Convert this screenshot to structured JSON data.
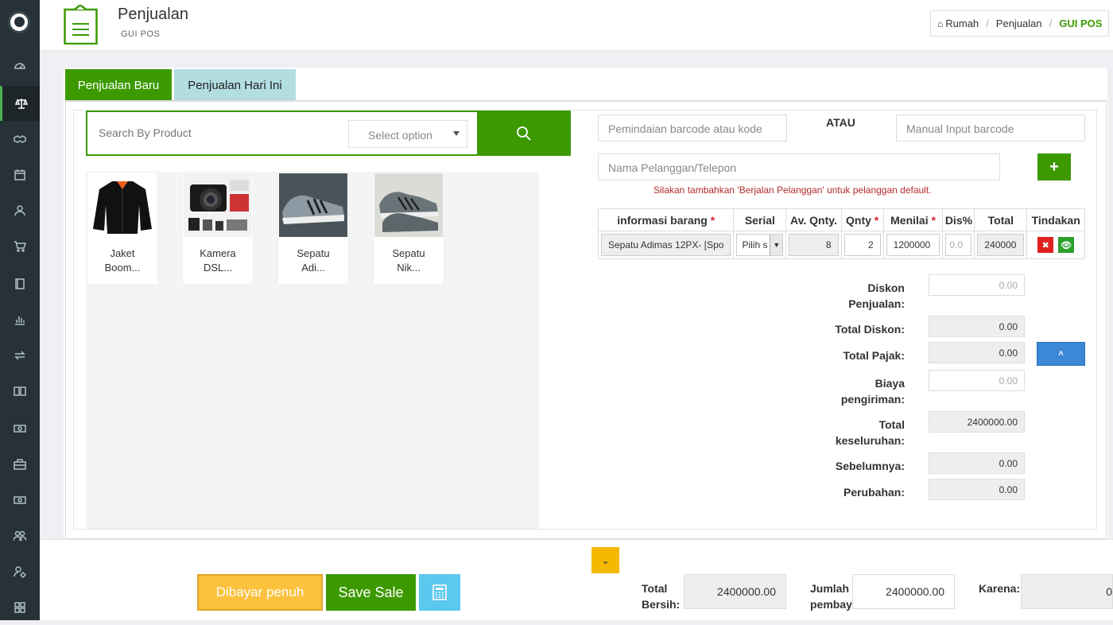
{
  "header": {
    "title": "Penjualan",
    "subtitle": "GUI POS",
    "breadcrumb": [
      "Rumah",
      "Penjualan",
      "GUI POS"
    ]
  },
  "sidebar": {
    "items": [
      "dashboard-icon",
      "scale-icon",
      "handshake-icon",
      "calendar-icon",
      "user-icon",
      "cart-icon",
      "book-icon",
      "bar-chart-icon",
      "exchange-icon",
      "open-book-icon",
      "money-icon",
      "briefcase-icon",
      "money-icon",
      "users-icon",
      "settings-user-icon",
      "grid-icon"
    ]
  },
  "tabs": [
    "Penjualan Baru",
    "Penjualan Hari Ini"
  ],
  "search": {
    "placeholder": "Search By Product",
    "select_option": "Select option"
  },
  "products": [
    {
      "name": "Jaket Boom...",
      "line1": "Jaket",
      "line2": "Boom..."
    },
    {
      "name": "Kamera DSL...",
      "line1": "Kamera",
      "line2": "DSL..."
    },
    {
      "name": "Sepatu Adi...",
      "line1": "Sepatu",
      "line2": "Adi..."
    },
    {
      "name": "Sepatu Nik...",
      "line1": "Sepatu",
      "line2": "Nik..."
    }
  ],
  "barcode_placeholder": "Pemindaian barcode atau kode",
  "or_label": "ATAU",
  "manual_placeholder": "Manual Input barcode",
  "customer_placeholder": "Nama Pelanggan/Telepon",
  "customer_hint": "Silakan tambahkan 'Berjalan Pelanggan' untuk pelanggan default.",
  "table": {
    "headers": [
      "informasi barang",
      "Serial",
      "Av. Qnty.",
      "Qnty",
      "Menilai",
      "Dis%",
      "Total",
      "Tindakan"
    ],
    "row": {
      "item": "Sepatu Adimas 12PX- [Spo",
      "serial": "Pilih s",
      "available": "8",
      "qty": "2",
      "price": "1200000",
      "discount": "0.0",
      "total": "240000"
    }
  },
  "summary": {
    "diskon_penjualan": {
      "l1": "Diskon",
      "l2": "Penjualan:",
      "value": "0.00"
    },
    "total_diskon": {
      "label": "Total Diskon:",
      "value": "0.00"
    },
    "total_pajak": {
      "label": "Total Pajak:",
      "value": "0.00"
    },
    "biaya_pengiriman": {
      "l1": "Biaya",
      "l2": "pengiriman:",
      "value": "0.00"
    },
    "total_keseluruhan": {
      "l1": "Total",
      "l2": "keseluruhan:",
      "value": "2400000.00"
    },
    "sebelumnya": {
      "label": "Sebelumnya:",
      "value": "0.00"
    },
    "perubahan": {
      "label": "Perubahan:",
      "value": "0.00"
    }
  },
  "footer": {
    "pay_full": "Dibayar penuh",
    "save_sale": "Save Sale",
    "net_total": {
      "l1": "Total",
      "l2": "Bersih:",
      "value": "2400000.00"
    },
    "paid_amount": {
      "l1": "Jumlah",
      "l2": "pembay",
      "value": "2400000.00"
    },
    "due": {
      "label": "Karena:",
      "value": "0"
    }
  },
  "colors": {
    "primary": "#3c9a00",
    "sidebar": "#263238",
    "warning": "#fcc13d",
    "info": "#5bc8ef",
    "danger": "#e02020"
  }
}
